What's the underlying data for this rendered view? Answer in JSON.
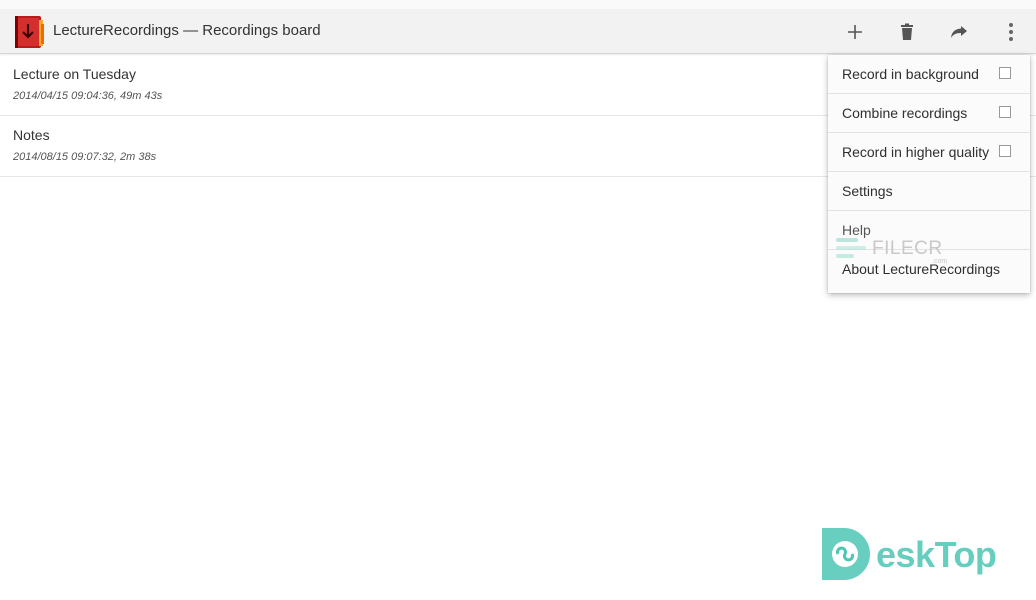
{
  "app": {
    "title": "LectureRecordings — Recordings board",
    "icon": "app-logo-icon"
  },
  "toolbar": {
    "add_icon": "plus-icon",
    "delete_icon": "trash-icon",
    "share_icon": "share-arrow-icon",
    "overflow_icon": "more-vertical-icon"
  },
  "recordings": [
    {
      "title": "Lecture on Tuesday",
      "details": "2014/04/15 09:04:36, 49m 43s"
    },
    {
      "title": "Notes",
      "details": "2014/08/15 09:07:32, 2m 38s"
    }
  ],
  "menu": {
    "items": [
      {
        "label": "Record in background",
        "checkbox": true,
        "checked": false
      },
      {
        "label": "Combine recordings",
        "checkbox": true,
        "checked": false
      },
      {
        "label": "Record in higher quality",
        "checkbox": true,
        "checked": false
      },
      {
        "label": "Settings",
        "checkbox": false
      },
      {
        "label": "Help",
        "checkbox": false
      },
      {
        "label": "About LectureRecordings",
        "checkbox": false
      }
    ]
  },
  "watermarks": {
    "filecr": "FILECR",
    "filecr_suffix": ".com",
    "desktop": "eskTop"
  },
  "colors": {
    "actionbar_bg": "#f2f2f2",
    "watermark_teal": "#4cc6b5",
    "app_icon_red": "#c62828"
  }
}
